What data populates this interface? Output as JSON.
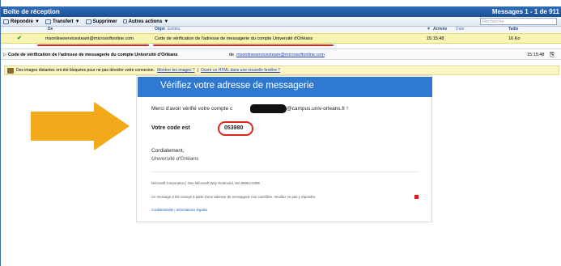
{
  "window": {
    "title": "Boîte de réception",
    "message_count": "Messages 1 - 1 de 911"
  },
  "toolbar": {
    "reply_label": "Répondre",
    "forward_label": "Transfert",
    "delete_label": "Supprimer",
    "more_actions_label": "Autres actions",
    "search_placeholder": "Recherche"
  },
  "list_headers": {
    "from": "De",
    "subject": "Objet",
    "subject_sub": "Entités",
    "received": "Arrivée",
    "received_sub": "Date",
    "size": "Taille"
  },
  "message": {
    "from": "msonlineservicesteam@microsoftonline.com",
    "subject": "Code de vérification de l'adresse de messagerie du compte Université d'Orléans",
    "time": "15:15:48",
    "size": "16 Ko"
  },
  "reading_pane": {
    "subject": "Code de vérification de l'adresse de messagerie du compte Université d'Orléans",
    "from_prefix": "de",
    "from": "msonlineservicesteam@microsoftonline.com",
    "time": "15:15:48"
  },
  "warning": {
    "text": "Des images distantes ont été bloquées pour ne pas dévoiler votre connexion.",
    "show_images": "Montrer les images ?",
    "open_html": "Ouvrir ce HTML dans une nouvelle fenêtre ?",
    "separator": "|"
  },
  "email": {
    "header": "Vérifiez votre adresse de messagerie",
    "thanks_prefix": "Merci d'avoir vérifié votre compte c",
    "thanks_suffix": "@campus.univ-orleans.fr !",
    "code_label": "Votre code est",
    "code": "053980",
    "regards": "Cordialement,",
    "org": "Université d'Orléans",
    "footer_address": "Microsoft Corporation | One Microsoft Way Redmond, WA 98052-6399",
    "footer_notice": "Ce message a été envoyé à partir d'une adresse de messagerie non contrôlée. Veuillez ne pas y répondre.",
    "footer_links": "Confidentialité | Informations légales"
  },
  "colors": {
    "title_blue": "#1a4f96",
    "header_blue": "#2f7ad0",
    "highlight_red": "#e0251b",
    "arrow_orange": "#f2a91b",
    "row_yellow": "#f7f4b4"
  },
  "icons": [
    "reply-icon",
    "forward-icon",
    "delete-icon",
    "check-icon",
    "sort-arrow-icon",
    "warning-image-icon",
    "attachment-icon",
    "arrow-annotation"
  ]
}
